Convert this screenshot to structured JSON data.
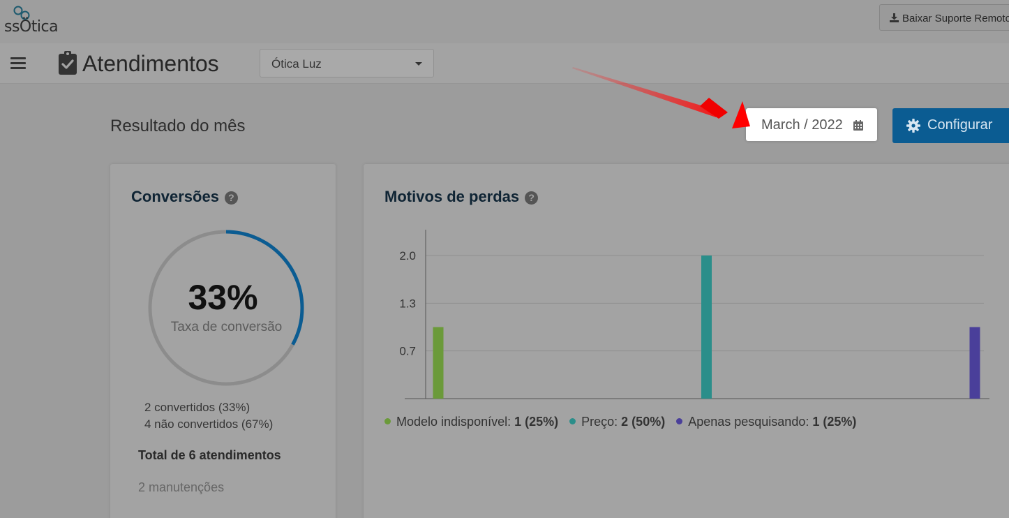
{
  "app": {
    "logo_text": "ssÖtica"
  },
  "topbar": {
    "support_label": "Baixar Suporte Remoto"
  },
  "header": {
    "title": "Atendimentos",
    "store": "Ótica Luz"
  },
  "section": {
    "title": "Resultado do mês",
    "month": "March / 2022",
    "config_label": "Configurar"
  },
  "conversions": {
    "title": "Conversões",
    "help": "?",
    "rate_value": 33,
    "rate_text": "33%",
    "rate_label": "Taxa de conversão",
    "converted": "2 convertidos (33%)",
    "not_converted": "4 não convertidos (67%)",
    "total": "Total de 6 atendimentos",
    "maintenance": "2 manutenções"
  },
  "losses": {
    "title": "Motivos de perdas",
    "help": "?",
    "legend": [
      {
        "label": "Modelo indisponível:",
        "value": "1 (25%)",
        "color": "#6b9a3a"
      },
      {
        "label": "Preço:",
        "value": "2 (50%)",
        "color": "#2b8e8a"
      },
      {
        "label": "Apenas pesquisando:",
        "value": "1 (25%)",
        "color": "#4a3f9a"
      }
    ]
  },
  "chart_data": {
    "type": "bar",
    "categories": [
      "Modelo indisponível",
      "Preço",
      "Apenas pesquisando"
    ],
    "values": [
      1,
      2,
      1
    ],
    "colors": [
      "#6b9a3a",
      "#2b8e8a",
      "#4a3f9a"
    ],
    "yticks": [
      "0.7",
      "1.3",
      "2.0"
    ],
    "ylim": [
      0,
      2.2
    ],
    "grid": true
  }
}
